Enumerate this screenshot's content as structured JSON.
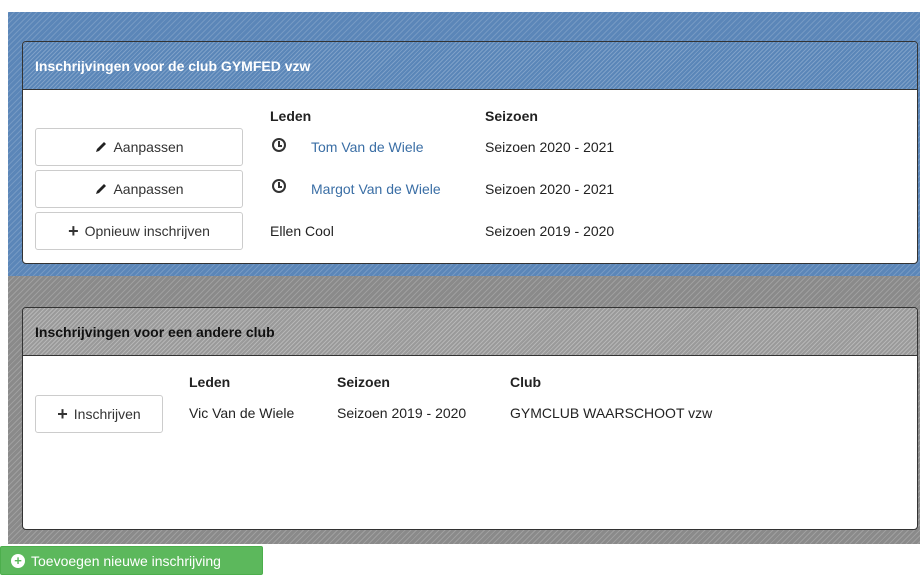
{
  "own_club": {
    "title": "Inschrijvingen voor de club GYMFED vzw",
    "headers": {
      "members": "Leden",
      "season": "Seizoen"
    },
    "rows": [
      {
        "button_label": "Aanpassen",
        "button_icon": "pencil-icon",
        "status_icon": "clock-icon",
        "member": "Tom Van de Wiele",
        "season": "Seizoen 2020 - 2021"
      },
      {
        "button_label": "Aanpassen",
        "button_icon": "pencil-icon",
        "status_icon": "clock-icon",
        "member": "Margot Van de Wiele",
        "season": "Seizoen 2020 - 2021"
      },
      {
        "button_label": "Opnieuw inschrijven",
        "button_icon": "plus-icon",
        "member": "Ellen Cool",
        "season": "Seizoen 2019 - 2020"
      }
    ]
  },
  "other_club": {
    "title": "Inschrijvingen voor een andere club",
    "headers": {
      "members": "Leden",
      "season": "Seizoen",
      "club": "Club"
    },
    "rows": [
      {
        "button_label": "Inschrijven",
        "button_icon": "plus-icon",
        "member": "Vic Van de Wiele",
        "season": "Seizoen 2019 - 2020",
        "club": "GYMCLUB WAARSCHOOT vzw"
      }
    ]
  },
  "add_button": {
    "label": "Toevoegen nieuwe inschrijving",
    "icon": "plus-circle-icon"
  },
  "colors": {
    "own_club_header": "#5a86b8",
    "other_club_header": "#9a9a9a",
    "link": "#3a6ea5",
    "add_button": "#5cb85c"
  }
}
